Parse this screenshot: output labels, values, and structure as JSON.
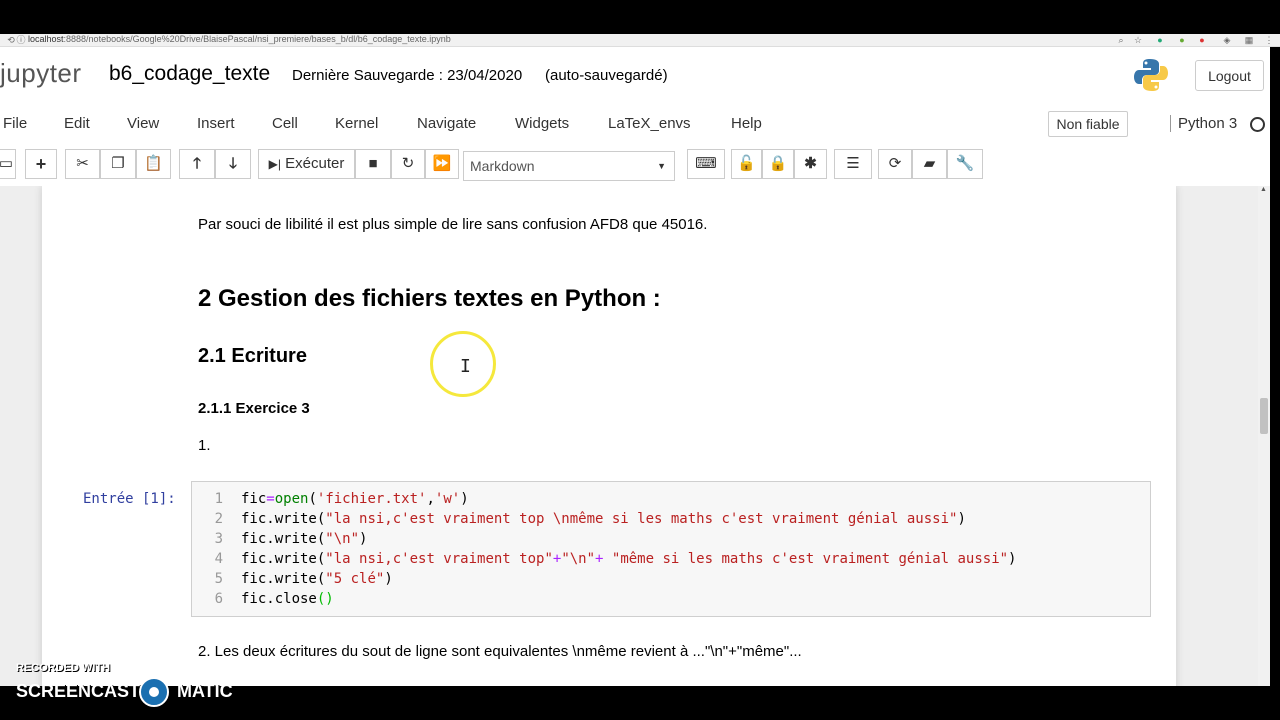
{
  "browser": {
    "url_host": "localhost",
    "url_rest": ":8888/notebooks/Google%20Drive/BlaisePascal/nsi_premiere/bases_b/dl/b6_codage_texte.ipynb"
  },
  "header": {
    "logo": "jupyter",
    "notebook_name": "b6_codage_texte",
    "last_saved": "Dernière Sauvegarde : 23/04/2020",
    "autosave": "(auto-sauvegardé)",
    "logout": "Logout"
  },
  "menu": {
    "items": [
      "File",
      "Edit",
      "View",
      "Insert",
      "Cell",
      "Kernel",
      "Navigate",
      "Widgets",
      "LaTeX_envs",
      "Help"
    ],
    "trust": "Non fiable",
    "kernel": "Python 3"
  },
  "toolbar": {
    "run_label": "Exécuter",
    "cell_type": "Markdown"
  },
  "notebook": {
    "para1": "Par souci de libilité il est plus simple de lire sans confusion AFD8 que 45016.",
    "heading1": "2  Gestion des fichiers textes en Python :",
    "heading2": "2.1  Ecriture",
    "heading3": "2.1.1  Exercice 3",
    "list_item": "1.",
    "prompt": "Entrée [1]:",
    "line_numbers": [
      "1",
      "2",
      "3",
      "4",
      "5",
      "6"
    ],
    "code": {
      "l1": [
        "fic",
        "=",
        "open",
        "(",
        "'fichier.txt'",
        ",",
        "'w'",
        ")"
      ],
      "l2": [
        "fic.write(",
        "\"la nsi,c'est vraiment top \\nmême si les maths c'est vraiment génial aussi\"",
        ")"
      ],
      "l3": [
        "fic.write(",
        "\"\\n\"",
        ")"
      ],
      "l4": [
        "fic.write(",
        "\"la nsi,c'est vraiment top\"",
        "+",
        "\"\\n\"",
        "+",
        " \"même si les maths c'est vraiment génial aussi\"",
        ")"
      ],
      "l5": [
        "fic.write(",
        "\"5 clé\"",
        ")"
      ],
      "l6": [
        "fic.close",
        "()"
      ]
    },
    "para2": "2. Les deux écritures du sout de ligne sont equivalentes \\nmême revient à ...\"\\n\"+\"même\"..."
  },
  "watermark": {
    "recorded": "RECORDED WITH",
    "brand_left": "SCREENCAST",
    "brand_right": "MATIC"
  }
}
